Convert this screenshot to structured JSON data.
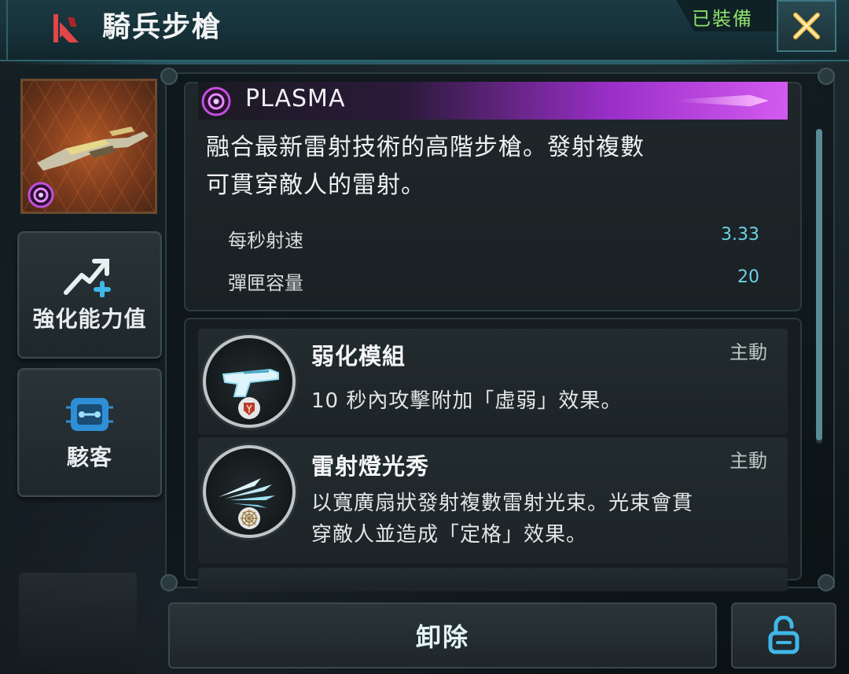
{
  "header": {
    "title": "騎兵步槍",
    "equipped_label": "已裝備",
    "close_icon": "close-x-icon",
    "weapon_type_icon": "rifle-class-icon"
  },
  "sidebar": {
    "upgrade_label": "強化能力值",
    "upgrade_icon": "upgrade-arrow-plus-icon",
    "hack_label": "駭客",
    "hack_icon": "chip-hack-icon"
  },
  "weapon": {
    "damage_type": "PLASMA",
    "damage_type_icon": "plasma-icon",
    "description": "融合最新雷射技術的高階步槍。發射複數可貫穿敵人的雷射。",
    "description_line1": "融合最新雷射技術的高階步槍。發射複數",
    "description_line2": "可貫穿敵人的雷射。",
    "stats": [
      {
        "name": "每秒射速",
        "value": "3.33"
      },
      {
        "name": "彈匣容量",
        "value": "20"
      }
    ]
  },
  "skills": [
    {
      "name": "弱化模組",
      "type": "主動",
      "description": "10 秒內攻擊附加「虛弱」效果。",
      "icon": "pistol-icon",
      "badge_icon": "weaken-badge-icon"
    },
    {
      "name": "雷射燈光秀",
      "type": "主動",
      "description_line1": "以寬廣扇狀發射複數雷射光束。光束會貫",
      "description_line2": "穿敵人並造成「定格」效果。",
      "icon": "laser-fan-icon",
      "badge_icon": "web-badge-icon"
    }
  ],
  "footer": {
    "unequip_label": "卸除",
    "lock_icon": "unlock-icon"
  },
  "colors": {
    "accent_cyan": "#6fd0e6",
    "equipped_green": "#8fe06a",
    "plasma_purple": "#d35af0",
    "close_gold": "#f2c04a"
  }
}
